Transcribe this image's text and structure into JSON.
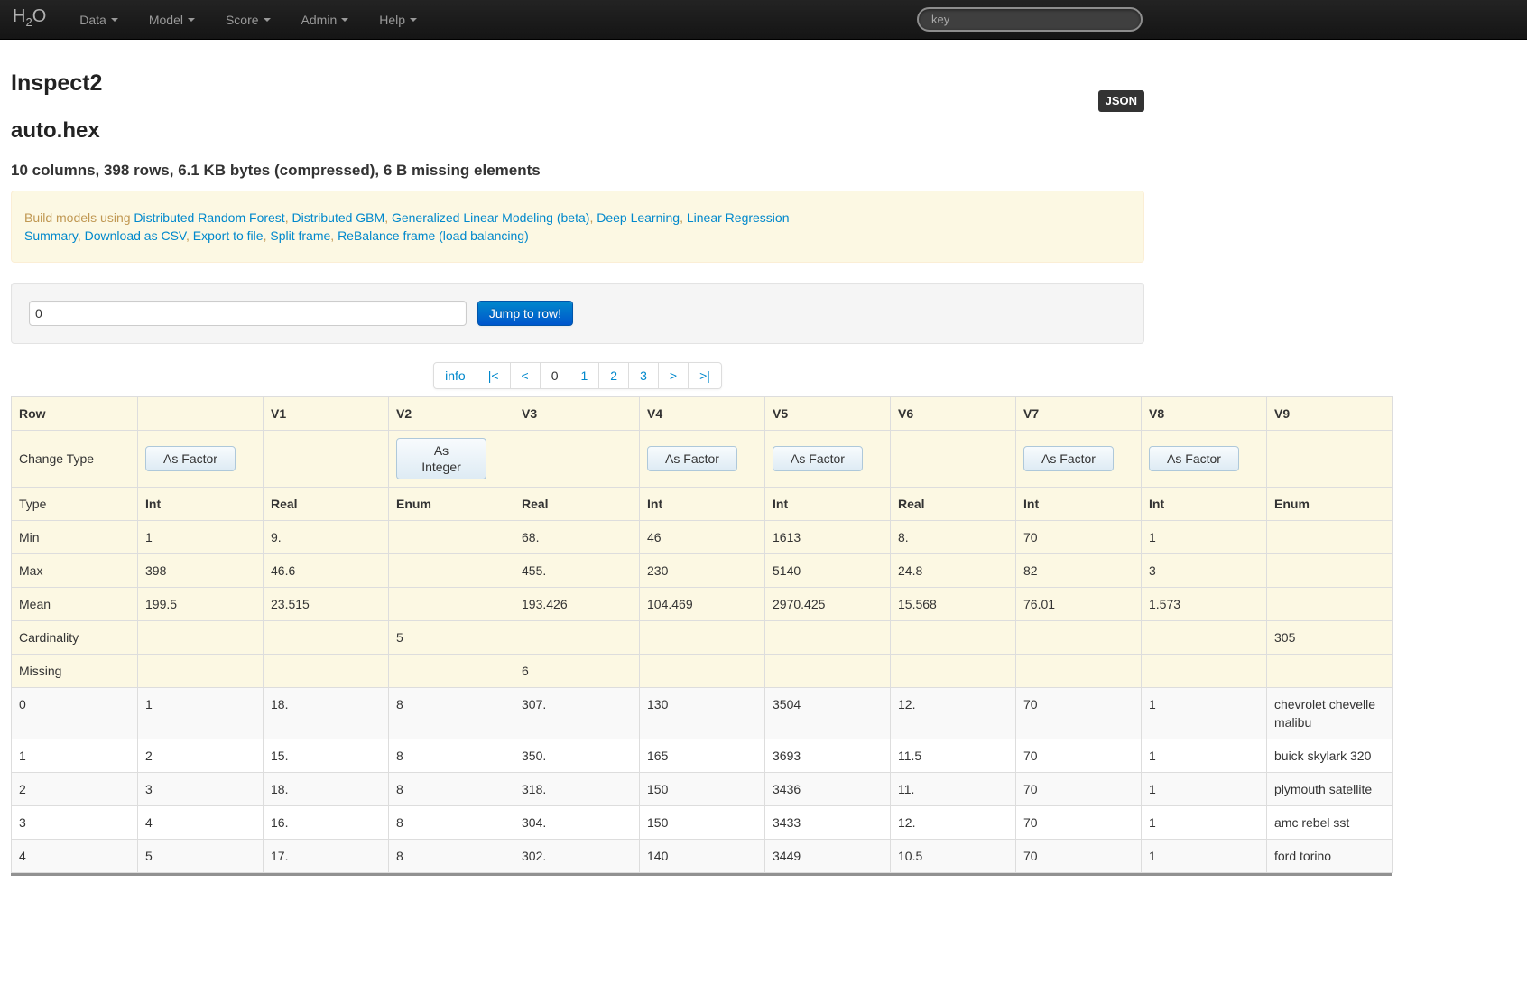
{
  "navbar": {
    "brand": {
      "pre": "H",
      "sub": "2",
      "post": "O"
    },
    "items": [
      "Data",
      "Model",
      "Score",
      "Admin",
      "Help"
    ],
    "search_placeholder": "key"
  },
  "header": {
    "json_label": "JSON",
    "page_title": "Inspect2",
    "frame_name": "auto.hex",
    "summary": "10 columns, 398 rows, 6.1 KB bytes (compressed), 6 B missing elements"
  },
  "alert": {
    "intro": "Build models using",
    "build_links": [
      "Distributed Random Forest",
      "Distributed GBM",
      "Generalized Linear Modeling (beta)",
      "Deep Learning",
      "Linear Regression"
    ],
    "action_links": [
      "Summary",
      "Download as CSV",
      "Export to file",
      "Split frame",
      "ReBalance frame (load balancing)"
    ]
  },
  "jump_row": {
    "value": "0",
    "button": "Jump to row!"
  },
  "pagination": {
    "items": [
      {
        "name": "info",
        "label": "info",
        "active": false
      },
      {
        "name": "first",
        "label": "|<",
        "active": false
      },
      {
        "name": "prev",
        "label": "<",
        "active": false
      },
      {
        "name": "page-0",
        "label": "0",
        "active": true
      },
      {
        "name": "page-1",
        "label": "1",
        "active": false
      },
      {
        "name": "page-2",
        "label": "2",
        "active": false
      },
      {
        "name": "page-3",
        "label": "3",
        "active": false
      },
      {
        "name": "next",
        "label": ">",
        "active": false
      },
      {
        "name": "last",
        "label": ">|",
        "active": false
      }
    ]
  },
  "table": {
    "headers": [
      "Row",
      "",
      "V1",
      "V2",
      "V3",
      "V4",
      "V5",
      "V6",
      "V7",
      "V8",
      "V9"
    ],
    "change_type_label": "Change Type",
    "change_type_buttons": [
      "As Factor",
      "",
      "As\nInteger",
      "",
      "As Factor",
      "As Factor",
      "",
      "As Factor",
      "As Factor",
      ""
    ],
    "stat_rows": [
      {
        "label": "Type",
        "bold": true,
        "values": [
          "Int",
          "Real",
          "Enum",
          "Real",
          "Int",
          "Int",
          "Real",
          "Int",
          "Int",
          "Enum"
        ]
      },
      {
        "label": "Min",
        "values": [
          "1",
          "9.",
          "",
          "68.",
          "46",
          "1613",
          "8.",
          "70",
          "1",
          ""
        ]
      },
      {
        "label": "Max",
        "values": [
          "398",
          "46.6",
          "",
          "455.",
          "230",
          "5140",
          "24.8",
          "82",
          "3",
          ""
        ]
      },
      {
        "label": "Mean",
        "values": [
          "199.5",
          "23.515",
          "",
          "193.426",
          "104.469",
          "2970.425",
          "15.568",
          "76.01",
          "1.573",
          ""
        ]
      },
      {
        "label": "Cardinality",
        "values": [
          "",
          "",
          "5",
          "",
          "",
          "",
          "",
          "",
          "",
          "305"
        ]
      },
      {
        "label": "Missing",
        "values": [
          "",
          "",
          "",
          "6",
          "",
          "",
          "",
          "",
          "",
          ""
        ]
      }
    ],
    "data_rows": [
      {
        "label": "0",
        "values": [
          "1",
          "18.",
          "8",
          "307.",
          "130",
          "3504",
          "12.",
          "70",
          "1",
          "chevrolet chevelle malibu"
        ]
      },
      {
        "label": "1",
        "values": [
          "2",
          "15.",
          "8",
          "350.",
          "165",
          "3693",
          "11.5",
          "70",
          "1",
          "buick skylark 320"
        ]
      },
      {
        "label": "2",
        "values": [
          "3",
          "18.",
          "8",
          "318.",
          "150",
          "3436",
          "11.",
          "70",
          "1",
          "plymouth satellite"
        ]
      },
      {
        "label": "3",
        "values": [
          "4",
          "16.",
          "8",
          "304.",
          "150",
          "3433",
          "12.",
          "70",
          "1",
          "amc rebel sst"
        ]
      },
      {
        "label": "4",
        "values": [
          "5",
          "17.",
          "8",
          "302.",
          "140",
          "3449",
          "10.5",
          "70",
          "1",
          "ford torino"
        ]
      }
    ]
  },
  "colors": {
    "link_blue": "#0088cc",
    "alert_text": "#c09853",
    "alert_bg": "#fcf8e3",
    "alert_border": "#fbeed5",
    "warning_row_bg": "#fcf8e3",
    "primary_btn_top": "#0088cc",
    "primary_btn_bottom": "#0055cc",
    "navbar_bg": "#1b1b1b"
  }
}
